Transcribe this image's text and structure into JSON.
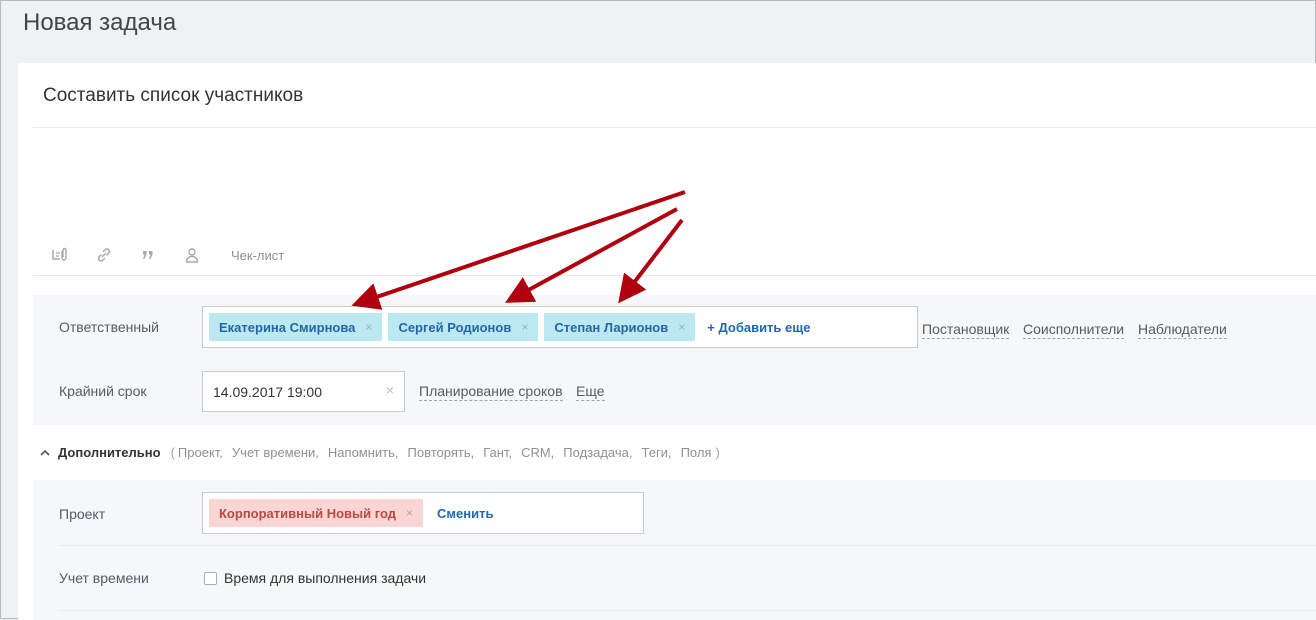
{
  "page": {
    "title": "Новая задача"
  },
  "task": {
    "title": "Составить список участников"
  },
  "toolbar": {
    "checklist_label": "Чек-лист"
  },
  "responsible": {
    "label": "Ответственный",
    "people": [
      "Екатерина Смирнова",
      "Сергей Родионов",
      "Степан Ларионов"
    ],
    "remove_glyph": "×",
    "add_more": "+ Добавить еще",
    "links": [
      "Постановщик",
      "Соисполнители",
      "Наблюдатели"
    ]
  },
  "deadline": {
    "label": "Крайний срок",
    "value": "14.09.2017 19:00",
    "clear_glyph": "×",
    "planning_link": "Планирование сроков",
    "more_link": "Еще"
  },
  "additional": {
    "label": "Дополнительно",
    "open_paren": "(",
    "close_paren": ")",
    "items": [
      "Проект,",
      "Учет времени,",
      "Напомнить,",
      "Повторять,",
      "Гант,",
      "CRM,",
      "Подзадача,",
      "Теги,",
      "Поля"
    ]
  },
  "project": {
    "label": "Проект",
    "value": "Корпоративный Новый год",
    "remove_glyph": "×",
    "change_link": "Сменить"
  },
  "time_tracking": {
    "label": "Учет времени",
    "checkbox_label": "Время для выполнения задачи",
    "checked": false
  },
  "colors": {
    "arrow": "#b0000e",
    "tag_blue": "#bce8f1",
    "tag_red": "#fbd4d4"
  },
  "icons": [
    "attach-icon",
    "link-icon",
    "quote-icon",
    "user-icon"
  ]
}
